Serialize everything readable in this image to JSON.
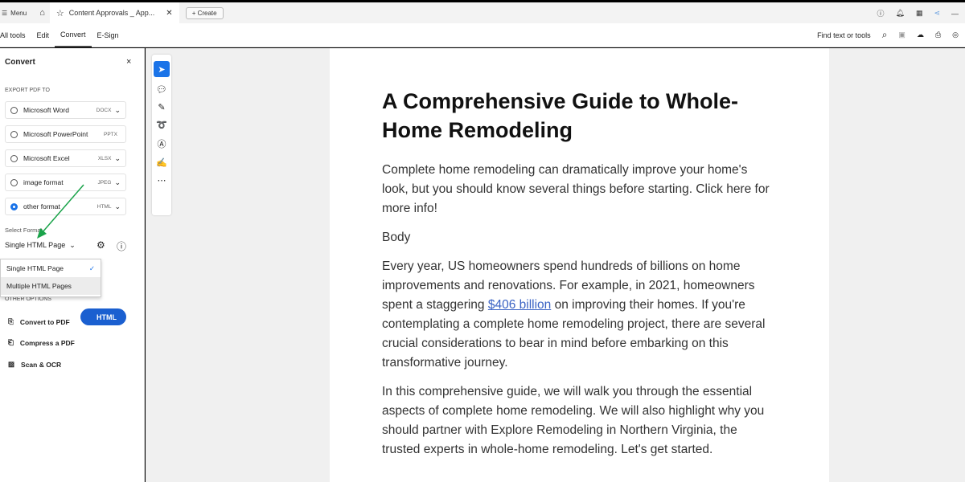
{
  "topbar": {
    "menu": "Menu",
    "tab_title": "Content Approvals _ App...",
    "create": "Create"
  },
  "toolbar": {
    "tabs": [
      "All tools",
      "Edit",
      "Convert",
      "E-Sign"
    ],
    "active": "Convert",
    "find": "Find text or tools"
  },
  "sidebar": {
    "title": "Convert",
    "export_label": "EXPORT PDF TO",
    "options": [
      {
        "label": "Microsoft Word",
        "ext": "DOCX",
        "selected": false
      },
      {
        "label": "Microsoft PowerPoint",
        "ext": "PPTX",
        "selected": false
      },
      {
        "label": "Microsoft Excel",
        "ext": "XLSX",
        "selected": false
      },
      {
        "label": "image format",
        "ext": "JPEG",
        "selected": false
      },
      {
        "label": "other format",
        "ext": "HTML",
        "selected": true
      }
    ],
    "select_format_label": "Select Format",
    "selected_format": "Single HTML Page",
    "dropdown": [
      "Single HTML Page",
      "Multiple HTML Pages"
    ],
    "convert_button": "HTML",
    "other_options_label": "OTHER OPTIONS",
    "other_options": [
      "Convert to PDF",
      "Compress a PDF",
      "Scan & OCR"
    ]
  },
  "document": {
    "title": "A Comprehensive Guide to Whole-Home Remodeling",
    "p1": "Complete home remodeling can dramatically improve your home's look, but you should know several things before starting. Click here for more info!",
    "p2": "Body",
    "p3a": "Every year, US homeowners spend hundreds of billions on home improvements and renovations. For example, in 2021, homeowners spent a staggering ",
    "p3link": "$406 billion",
    "p3b": " on improving their homes. If you're contemplating a complete home remodeling project, there are several crucial considerations to bear in mind before embarking on this transformative journey.",
    "p4": "In this comprehensive guide, we will walk you through the essential aspects of complete home remodeling. We will also highlight why you should partner with Explore Remodeling in Northern Virginia, the trusted experts in whole-home remodeling. Let's get started."
  },
  "colors": {
    "accent": "#1a73e8",
    "link": "#3b63c4",
    "arrow": "#1aa34a"
  }
}
